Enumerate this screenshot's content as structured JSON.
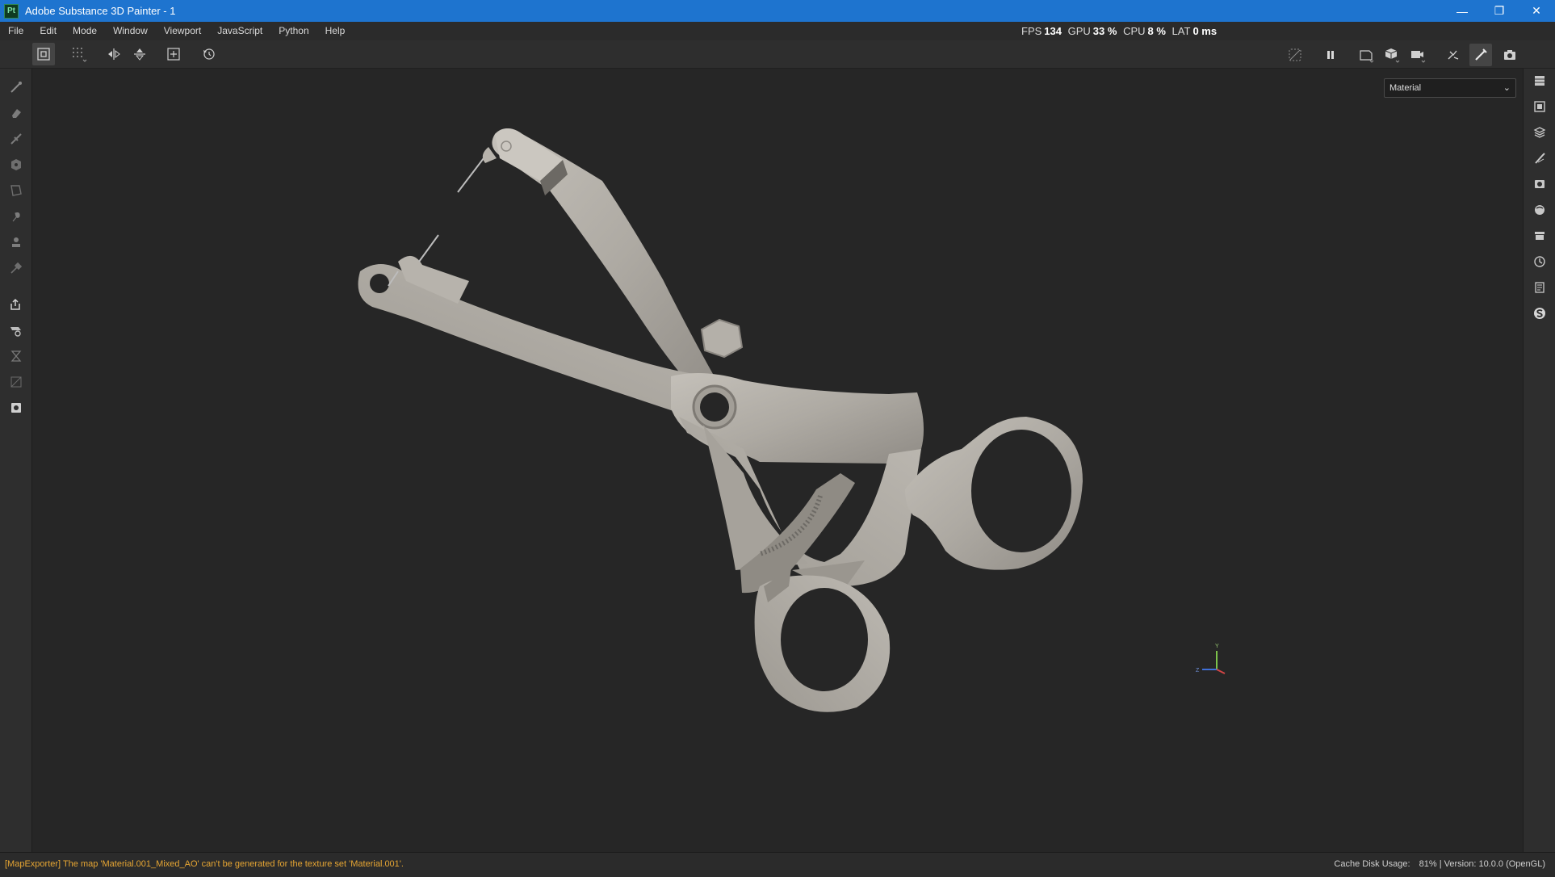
{
  "window": {
    "app_icon": "Pt",
    "title": "Adobe Substance 3D Painter - 1",
    "minimize_icon": "minimize-icon",
    "restore_icon": "restore-icon",
    "close_icon": "close-icon"
  },
  "menu": [
    "File",
    "Edit",
    "Mode",
    "Window",
    "Viewport",
    "JavaScript",
    "Python",
    "Help"
  ],
  "perf": {
    "fps_label": "FPS",
    "fps_value": "134",
    "gpu_label": "GPU",
    "gpu_value": "33 %",
    "cpu_label": "CPU",
    "cpu_value": "8 %",
    "lat_label": "LAT",
    "lat_value": "0 ms"
  },
  "toolbar": {
    "left_icons": [
      "selection-mode-icon",
      "grid-snap-icon",
      "mirror-x-icon",
      "mirror-y-icon",
      "add-frame-icon",
      "reset-rotation-icon"
    ],
    "right_icons": [
      "hide-overlay-icon",
      "pause-icon",
      "viewport-frame-icon",
      "cube-view-icon",
      "camera-icon",
      "bake-icon",
      "paint-mode-icon",
      "screenshot-icon"
    ]
  },
  "left_tools": [
    "paint-brush-icon",
    "eraser-icon",
    "projection-icon",
    "geometry-mask-icon",
    "polygon-fill-icon",
    "smudge-icon",
    "clone-stamp-icon",
    "color-picker-icon",
    "export-icon",
    "bake-textures-icon",
    "hourglass-icon",
    "uv-icon",
    "document-icon"
  ],
  "right_tools": [
    "layers-stack-icon",
    "texture-set-icon",
    "layers-icon",
    "properties-icon",
    "display-settings-icon",
    "shader-icon",
    "assets-icon",
    "history-icon",
    "log-icon",
    "substance-icon"
  ],
  "viewport": {
    "display_mode": "Material",
    "axis_labels": {
      "x": "X",
      "y": "Y",
      "z": "Z"
    }
  },
  "status": {
    "message": "[MapExporter] The map 'Material.001_Mixed_AO' can't be generated for the texture set 'Material.001'.",
    "cache_label": "Cache Disk Usage:",
    "cache_value": "81%",
    "version": "| Version: 10.0.0 (OpenGL)"
  }
}
